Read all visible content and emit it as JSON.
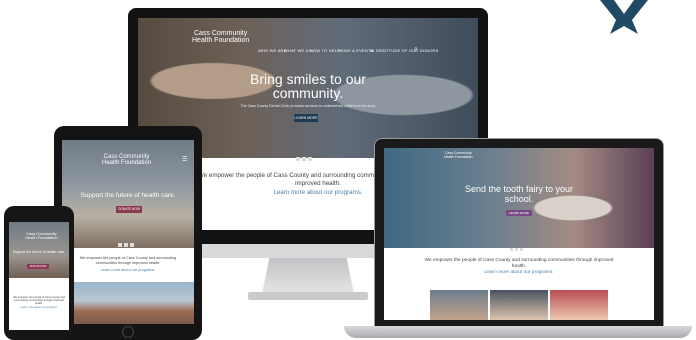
{
  "brand": {
    "name_line1": "Cass Community",
    "name_line2": "Health Foundation",
    "arrow_color": "#1e4a64"
  },
  "desktop": {
    "nav": [
      "WHO WE ARE",
      "WHAT WE DO",
      "HOW TO HELP",
      "NEWS & EVENTS",
      "IN GRATITUDE OF OUR DONORS"
    ],
    "hero_title": "Bring smiles to our community.",
    "hero_subtitle": "The Cass County Dental Clinic provides services to underserved children in the area.",
    "hero_button": "LEARN MORE",
    "tagline": "We empower the people of Cass County and surrounding communities through improved health.",
    "tagline_visible": "We empower the people of Cass County and surrounding commu",
    "tagline_line2": "improved health.",
    "link": "Learn more about our programs."
  },
  "tablet": {
    "hero_title": "Support the future of health care.",
    "hero_button": "DONATE NOW",
    "tagline": "We empower the people of Cass County and surrounding communities through improved health.",
    "link": "Learn more about our programs."
  },
  "phone": {
    "hero_title": "Support the future of health care.",
    "hero_button": "DONATE NOW",
    "tagline": "We empower the people of Cass County and surrounding communities through improved health.",
    "link": "Learn more about our programs."
  },
  "laptop": {
    "hero_title": "Send the tooth fairy to your school.",
    "hero_button": "LEARN MORE",
    "tagline": "We empower the people of Cass County and surrounding communities through improved health.",
    "link": "Learn more about our programs."
  },
  "colors": {
    "navy_button": "#1d3b52",
    "pink_button": "#8a3a52",
    "link_blue": "#4b7fa8"
  }
}
